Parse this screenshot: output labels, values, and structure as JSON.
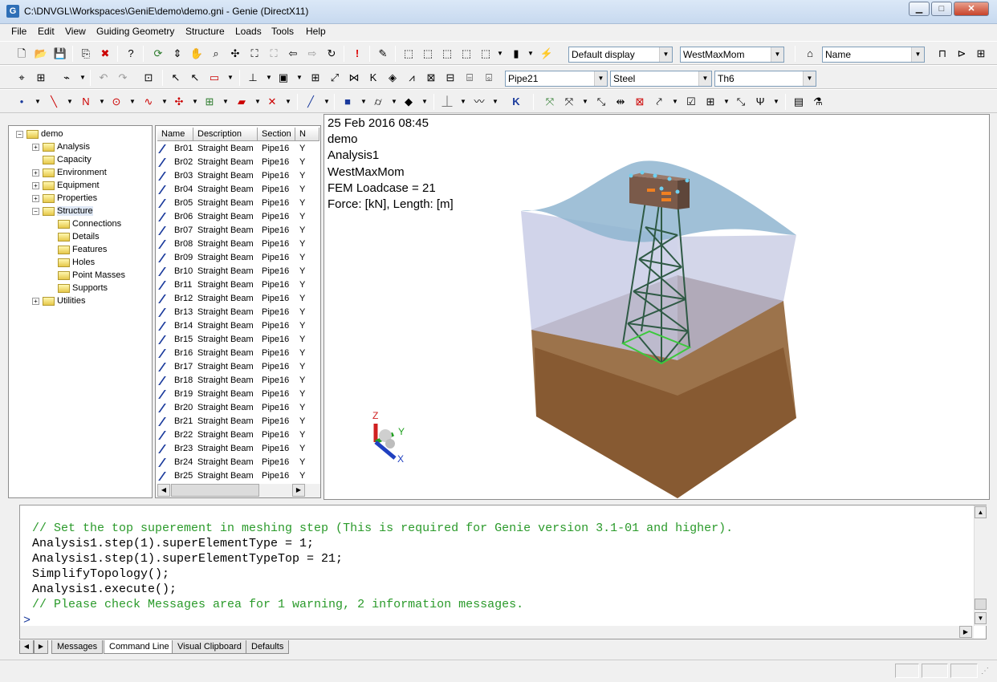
{
  "window": {
    "title": "C:\\DNVGL\\Workspaces\\GeniE\\demo\\demo.gni - Genie (DirectX11)",
    "icon": "G",
    "min_icon": "minimize-icon",
    "max_icon": "maximize-icon",
    "close_icon": "close-icon"
  },
  "menu": [
    "File",
    "Edit",
    "View",
    "Guiding Geometry",
    "Structure",
    "Loads",
    "Tools",
    "Help"
  ],
  "toolbar1": {
    "display": "Default display",
    "loadcase": "WestMaxMom",
    "label_mode": "Name"
  },
  "toolbar2": {
    "section": "Pipe21",
    "material": "Steel",
    "thickness": "Th6"
  },
  "tree": {
    "root": "demo",
    "items": [
      "Analysis",
      "Capacity",
      "Environment",
      "Equipment",
      "Properties",
      "Structure",
      "Connections",
      "Details",
      "Features",
      "Holes",
      "Point Masses",
      "Supports",
      "Utilities"
    ]
  },
  "list": {
    "columns": [
      "Name",
      "Description",
      "Section",
      "N"
    ],
    "rows": [
      [
        "Br01",
        "Straight Beam",
        "Pipe16",
        "Y"
      ],
      [
        "Br02",
        "Straight Beam",
        "Pipe16",
        "Y"
      ],
      [
        "Br03",
        "Straight Beam",
        "Pipe16",
        "Y"
      ],
      [
        "Br04",
        "Straight Beam",
        "Pipe16",
        "Y"
      ],
      [
        "Br05",
        "Straight Beam",
        "Pipe16",
        "Y"
      ],
      [
        "Br06",
        "Straight Beam",
        "Pipe16",
        "Y"
      ],
      [
        "Br07",
        "Straight Beam",
        "Pipe16",
        "Y"
      ],
      [
        "Br08",
        "Straight Beam",
        "Pipe16",
        "Y"
      ],
      [
        "Br09",
        "Straight Beam",
        "Pipe16",
        "Y"
      ],
      [
        "Br10",
        "Straight Beam",
        "Pipe16",
        "Y"
      ],
      [
        "Br11",
        "Straight Beam",
        "Pipe16",
        "Y"
      ],
      [
        "Br12",
        "Straight Beam",
        "Pipe16",
        "Y"
      ],
      [
        "Br13",
        "Straight Beam",
        "Pipe16",
        "Y"
      ],
      [
        "Br14",
        "Straight Beam",
        "Pipe16",
        "Y"
      ],
      [
        "Br15",
        "Straight Beam",
        "Pipe16",
        "Y"
      ],
      [
        "Br16",
        "Straight Beam",
        "Pipe16",
        "Y"
      ],
      [
        "Br17",
        "Straight Beam",
        "Pipe16",
        "Y"
      ],
      [
        "Br18",
        "Straight Beam",
        "Pipe16",
        "Y"
      ],
      [
        "Br19",
        "Straight Beam",
        "Pipe16",
        "Y"
      ],
      [
        "Br20",
        "Straight Beam",
        "Pipe16",
        "Y"
      ],
      [
        "Br21",
        "Straight Beam",
        "Pipe16",
        "Y"
      ],
      [
        "Br22",
        "Straight Beam",
        "Pipe16",
        "Y"
      ],
      [
        "Br23",
        "Straight Beam",
        "Pipe16",
        "Y"
      ],
      [
        "Br24",
        "Straight Beam",
        "Pipe16",
        "Y"
      ],
      [
        "Br25",
        "Straight Beam",
        "Pipe16",
        "Y"
      ]
    ]
  },
  "viewport": {
    "lines": [
      "25 Feb 2016 08:45",
      "demo",
      "Analysis1",
      "WestMaxMom",
      "FEM Loadcase = 21",
      "Force: [kN], Length: [m]"
    ],
    "axes": {
      "z": "Z",
      "y": "Y",
      "x": "X"
    }
  },
  "command": {
    "lines": [
      "// Set the top superement in meshing step (This is required for Genie version 3.1-01 and higher).",
      "Analysis1.step(1).superElementType = 1;",
      "Analysis1.step(1).superElementTypeTop = 21;",
      "SimplifyTopology();",
      "Analysis1.execute();",
      "// Please check Messages area for 1 warning, 2 information messages."
    ],
    "prompt": ">"
  },
  "tabs": [
    "Messages",
    "Command Line",
    "Visual Clipboard",
    "Defaults"
  ],
  "colors": {
    "comment": "#2a9a2a",
    "water": "#a9c6dc",
    "soil": "#8b5a2b"
  }
}
